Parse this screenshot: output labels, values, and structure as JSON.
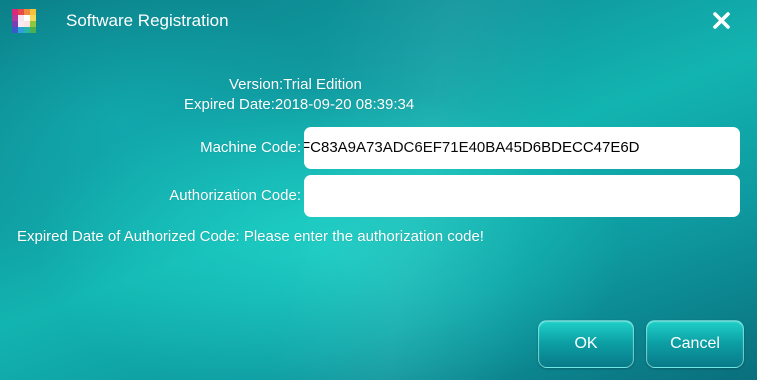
{
  "window": {
    "title": "Software Registration",
    "icon": "app-color-grid-icon",
    "close_icon": "close-icon"
  },
  "info": {
    "version_label": "Version:",
    "version_value": "Trial Edition",
    "expired_label": "Expired Date:",
    "expired_value": "2018-09-20 08:39:34"
  },
  "form": {
    "machine_code_label": "Machine Code:",
    "machine_code_value": "FC83A9A73ADC6EF71E40BA45D6BDECC47E6D",
    "authorization_code_label": "Authorization Code:",
    "authorization_code_value": "",
    "auth_expired_label": "Expired Date of Authorized Code:",
    "auth_expired_message": "Please enter the authorization code!"
  },
  "buttons": {
    "ok": "OK",
    "cancel": "Cancel"
  },
  "colors": {
    "background_dark": "#0a6f7c",
    "background_light": "#12b4b0",
    "text": "#ffffff",
    "field_background": "#ffffff",
    "button_top": "#1fd0c8",
    "button_bottom": "#087a88"
  }
}
